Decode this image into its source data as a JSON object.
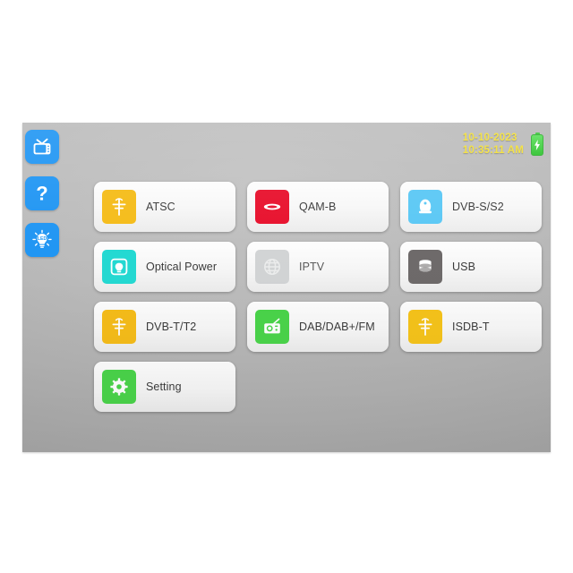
{
  "device": {
    "screen_label": "signal-analyzer-home-screen",
    "background_color": "#bbbbbb"
  },
  "sidebar": {
    "items": [
      {
        "name": "tv-icon",
        "label": "TV",
        "color": "#2196f3"
      },
      {
        "name": "help-icon",
        "label": "?",
        "color": "#2196f3"
      },
      {
        "name": "led-icon",
        "label": "LED",
        "color": "#2196f3"
      }
    ]
  },
  "status": {
    "date": "10-10-2023",
    "time": "10:35:11 AM",
    "text_color": "#f3e03a",
    "battery": {
      "state": "charging",
      "color": "#3ec43e"
    }
  },
  "menu": {
    "buttons": [
      {
        "label": "ATSC",
        "icon": "antenna-icon",
        "tile_color": "#f5bc19"
      },
      {
        "label": "QAM-B",
        "icon": "cable-icon",
        "tile_color": "#e8112d"
      },
      {
        "label": "DVB-S/S2",
        "icon": "satellite-dish-icon",
        "tile_color": "#5bc8f5"
      },
      {
        "label": "Optical Power",
        "icon": "optical-meter-icon",
        "tile_color": "#24d9d2"
      },
      {
        "label": "IPTV",
        "icon": "globe-icon",
        "tile_color": "#d2d4d5"
      },
      {
        "label": "USB",
        "icon": "storage-icon",
        "tile_color": "#6e6a6a"
      },
      {
        "label": "DVB-T/T2",
        "icon": "antenna-icon",
        "tile_color": "#f5bc19"
      },
      {
        "label": "DAB/DAB+/FM",
        "icon": "radio-icon",
        "tile_color": "#4ad44a"
      },
      {
        "label": "ISDB-T",
        "icon": "antenna-icon",
        "tile_color": "#f5c31a"
      },
      {
        "label": "Setting",
        "icon": "gear-icon",
        "tile_color": "#4ad44a"
      }
    ]
  }
}
